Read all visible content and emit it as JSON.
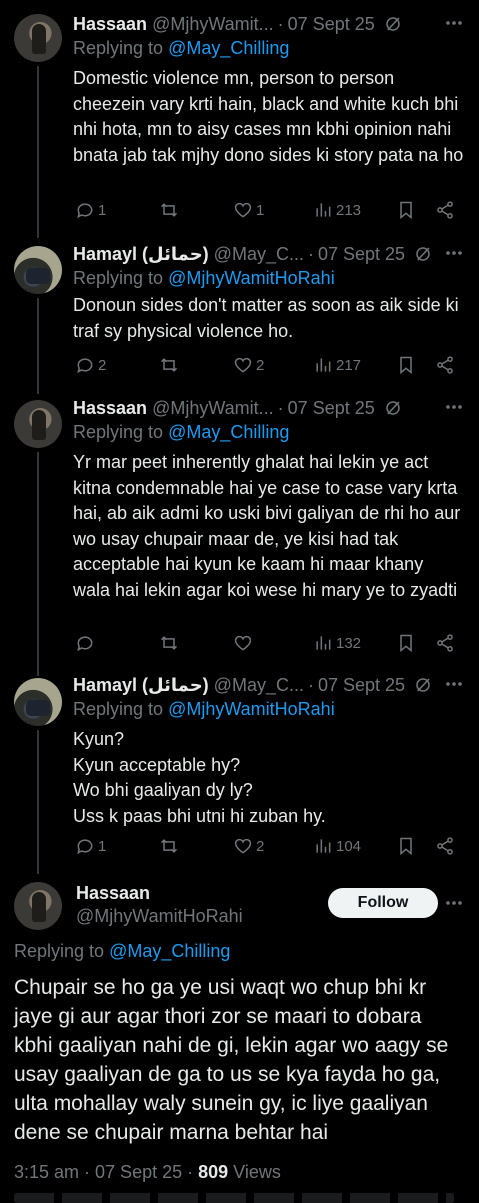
{
  "replies": [
    {
      "name": "Hassaan",
      "handle": "@MjhyWamit...",
      "date": "07 Sept 25",
      "replying_label": "Replying to ",
      "replying_to": "@May_Chilling",
      "text": "Domestic violence mn, person to person cheezein vary krti hain, black and white kuch bhi nhi hota, mn to aisy cases mn kbhi opinion nahi bnata jab tak mjhy dono sides ki story pata na ho",
      "replies": "1",
      "retweets": "",
      "likes": "1",
      "views": "213"
    },
    {
      "name": "Hamayl (حمائل)",
      "handle": "@May_C...",
      "date": "07 Sept 25",
      "replying_label": "Replying to ",
      "replying_to": "@MjhyWamitHoRahi",
      "text": "Donoun sides don't matter as soon as aik side ki traf sy physical violence ho.",
      "replies": "2",
      "retweets": "",
      "likes": "2",
      "views": "217"
    },
    {
      "name": "Hassaan",
      "handle": "@MjhyWamit...",
      "date": "07 Sept 25",
      "replying_label": "Replying to ",
      "replying_to": "@May_Chilling",
      "text": "Yr mar peet inherently ghalat hai lekin ye act kitna condemnable hai ye case to case vary krta hai, ab aik admi ko uski bivi galiyan de rhi ho aur wo usay chupair maar de, ye kisi had tak acceptable hai kyun ke kaam hi maar khany wala hai lekin agar koi wese hi mary ye to zyadti",
      "replies": "",
      "retweets": "",
      "likes": "",
      "views": "132"
    },
    {
      "name": "Hamayl (حمائل)",
      "handle": "@May_C...",
      "date": "07 Sept 25",
      "replying_label": "Replying to ",
      "replying_to": "@MjhyWamitHoRahi",
      "text": "Kyun?\nKyun acceptable hy?\nWo bhi gaaliyan dy ly?\nUss k paas bhi utni hi zuban hy.",
      "replies": "1",
      "retweets": "",
      "likes": "2",
      "views": "104"
    }
  ],
  "main_tweet": {
    "name": "Hassaan",
    "handle": "@MjhyWamitHoRahi",
    "follow_label": "Follow",
    "replying_label": "Replying to ",
    "replying_to": "@May_Chilling",
    "text": "Chupair se ho ga ye usi waqt wo chup bhi kr jaye gi aur agar thori zor se maari to dobara kbhi gaaliyan nahi de gi, lekin agar wo aagy se usay gaaliyan de ga to us se kya fayda ho ga, ulta mohallay waly sunein gy, ic liye gaaliyan dene se chupair marna behtar hai",
    "time": "3:15 am · 07 Sept 25 · ",
    "views_count": "809",
    "views_label": " Views"
  },
  "colors": {
    "background": "#000000",
    "text": "#e7e9ea",
    "muted": "#71767b",
    "link": "#1d9bf0",
    "follow_bg": "#eff3f4"
  }
}
